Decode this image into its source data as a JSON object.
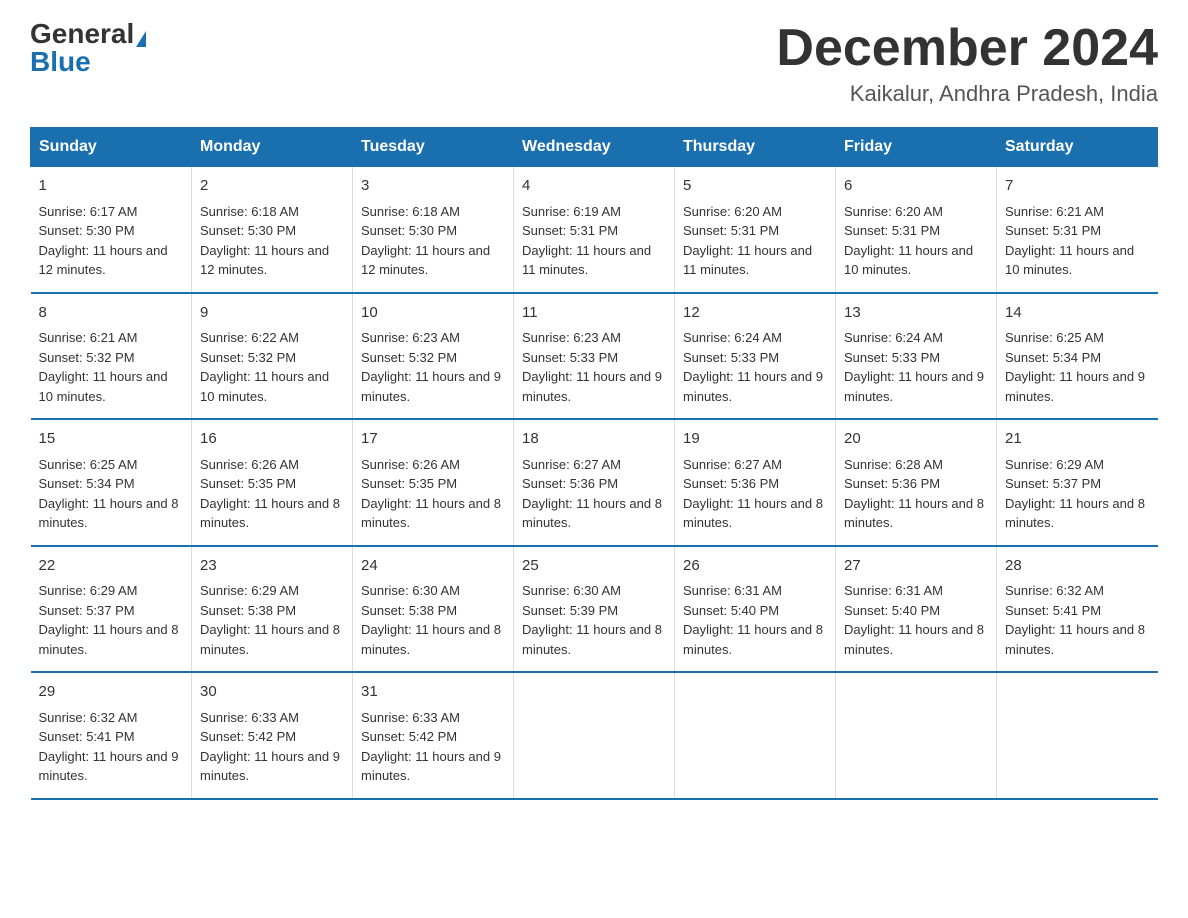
{
  "header": {
    "logo_general": "General",
    "logo_blue": "Blue",
    "month_title": "December 2024",
    "location": "Kaikalur, Andhra Pradesh, India"
  },
  "days_of_week": [
    "Sunday",
    "Monday",
    "Tuesday",
    "Wednesday",
    "Thursday",
    "Friday",
    "Saturday"
  ],
  "weeks": [
    [
      {
        "day": "1",
        "sunrise": "6:17 AM",
        "sunset": "5:30 PM",
        "daylight": "11 hours and 12 minutes."
      },
      {
        "day": "2",
        "sunrise": "6:18 AM",
        "sunset": "5:30 PM",
        "daylight": "11 hours and 12 minutes."
      },
      {
        "day": "3",
        "sunrise": "6:18 AM",
        "sunset": "5:30 PM",
        "daylight": "11 hours and 12 minutes."
      },
      {
        "day": "4",
        "sunrise": "6:19 AM",
        "sunset": "5:31 PM",
        "daylight": "11 hours and 11 minutes."
      },
      {
        "day": "5",
        "sunrise": "6:20 AM",
        "sunset": "5:31 PM",
        "daylight": "11 hours and 11 minutes."
      },
      {
        "day": "6",
        "sunrise": "6:20 AM",
        "sunset": "5:31 PM",
        "daylight": "11 hours and 10 minutes."
      },
      {
        "day": "7",
        "sunrise": "6:21 AM",
        "sunset": "5:31 PM",
        "daylight": "11 hours and 10 minutes."
      }
    ],
    [
      {
        "day": "8",
        "sunrise": "6:21 AM",
        "sunset": "5:32 PM",
        "daylight": "11 hours and 10 minutes."
      },
      {
        "day": "9",
        "sunrise": "6:22 AM",
        "sunset": "5:32 PM",
        "daylight": "11 hours and 10 minutes."
      },
      {
        "day": "10",
        "sunrise": "6:23 AM",
        "sunset": "5:32 PM",
        "daylight": "11 hours and 9 minutes."
      },
      {
        "day": "11",
        "sunrise": "6:23 AM",
        "sunset": "5:33 PM",
        "daylight": "11 hours and 9 minutes."
      },
      {
        "day": "12",
        "sunrise": "6:24 AM",
        "sunset": "5:33 PM",
        "daylight": "11 hours and 9 minutes."
      },
      {
        "day": "13",
        "sunrise": "6:24 AM",
        "sunset": "5:33 PM",
        "daylight": "11 hours and 9 minutes."
      },
      {
        "day": "14",
        "sunrise": "6:25 AM",
        "sunset": "5:34 PM",
        "daylight": "11 hours and 9 minutes."
      }
    ],
    [
      {
        "day": "15",
        "sunrise": "6:25 AM",
        "sunset": "5:34 PM",
        "daylight": "11 hours and 8 minutes."
      },
      {
        "day": "16",
        "sunrise": "6:26 AM",
        "sunset": "5:35 PM",
        "daylight": "11 hours and 8 minutes."
      },
      {
        "day": "17",
        "sunrise": "6:26 AM",
        "sunset": "5:35 PM",
        "daylight": "11 hours and 8 minutes."
      },
      {
        "day": "18",
        "sunrise": "6:27 AM",
        "sunset": "5:36 PM",
        "daylight": "11 hours and 8 minutes."
      },
      {
        "day": "19",
        "sunrise": "6:27 AM",
        "sunset": "5:36 PM",
        "daylight": "11 hours and 8 minutes."
      },
      {
        "day": "20",
        "sunrise": "6:28 AM",
        "sunset": "5:36 PM",
        "daylight": "11 hours and 8 minutes."
      },
      {
        "day": "21",
        "sunrise": "6:29 AM",
        "sunset": "5:37 PM",
        "daylight": "11 hours and 8 minutes."
      }
    ],
    [
      {
        "day": "22",
        "sunrise": "6:29 AM",
        "sunset": "5:37 PM",
        "daylight": "11 hours and 8 minutes."
      },
      {
        "day": "23",
        "sunrise": "6:29 AM",
        "sunset": "5:38 PM",
        "daylight": "11 hours and 8 minutes."
      },
      {
        "day": "24",
        "sunrise": "6:30 AM",
        "sunset": "5:38 PM",
        "daylight": "11 hours and 8 minutes."
      },
      {
        "day": "25",
        "sunrise": "6:30 AM",
        "sunset": "5:39 PM",
        "daylight": "11 hours and 8 minutes."
      },
      {
        "day": "26",
        "sunrise": "6:31 AM",
        "sunset": "5:40 PM",
        "daylight": "11 hours and 8 minutes."
      },
      {
        "day": "27",
        "sunrise": "6:31 AM",
        "sunset": "5:40 PM",
        "daylight": "11 hours and 8 minutes."
      },
      {
        "day": "28",
        "sunrise": "6:32 AM",
        "sunset": "5:41 PM",
        "daylight": "11 hours and 8 minutes."
      }
    ],
    [
      {
        "day": "29",
        "sunrise": "6:32 AM",
        "sunset": "5:41 PM",
        "daylight": "11 hours and 9 minutes."
      },
      {
        "day": "30",
        "sunrise": "6:33 AM",
        "sunset": "5:42 PM",
        "daylight": "11 hours and 9 minutes."
      },
      {
        "day": "31",
        "sunrise": "6:33 AM",
        "sunset": "5:42 PM",
        "daylight": "11 hours and 9 minutes."
      },
      null,
      null,
      null,
      null
    ]
  ]
}
